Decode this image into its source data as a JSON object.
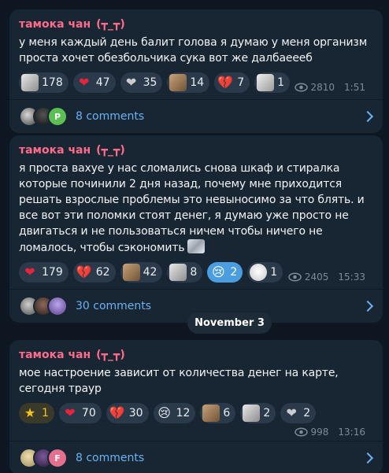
{
  "posts": [
    {
      "author": "тамока чан",
      "author_kaomoji": "(┳_┳)",
      "text": "у меня каждый день балит голова я думаю у меня организм проста хочет обезбольчика сука вот же далбаеееб",
      "reactions": [
        {
          "icon": "sticker-meme-face",
          "count": "178"
        },
        {
          "icon": "red-heart",
          "count": "47"
        },
        {
          "icon": "sticker-gray-heart",
          "count": "35"
        },
        {
          "icon": "sticker-cat-face",
          "count": "14"
        },
        {
          "icon": "broken-heart",
          "count": "7"
        },
        {
          "icon": "sticker-troll-face",
          "count": "1"
        }
      ],
      "views": "2810",
      "time": "1:51",
      "comments": "8 comments",
      "commenter_badge": "P"
    },
    {
      "author": "тамока чан",
      "author_kaomoji": "(┳_┳)",
      "text": "я проста вахуе у нас сломались снова шкаф и стиралка которые починили 2 дня назад, почему мне приходится решать взрослые проблемы это невыносимо за что блять. и все вот эти поломки стоят денег, я думаю уже просто не двигаться и не пользоваться ничем чтобы ничего не ломалось, чтобы сэкономить",
      "reactions": [
        {
          "icon": "red-heart",
          "count": "179"
        },
        {
          "icon": "broken-heart",
          "count": "62"
        },
        {
          "icon": "sticker-cat-face",
          "count": "42"
        },
        {
          "icon": "sticker-meme-face",
          "count": "8"
        },
        {
          "icon": "crying-face",
          "count": "2"
        },
        {
          "icon": "sticker-white-blob",
          "count": "1"
        }
      ],
      "views": "2405",
      "time": "15:33",
      "comments": "30 comments"
    },
    {
      "author": "тамока чан",
      "author_kaomoji": "(┳_┳)",
      "text": "мое настроение зависит от количества денег на карте, сегодня траур",
      "reactions": [
        {
          "icon": "star",
          "count": "1"
        },
        {
          "icon": "red-heart",
          "count": "70"
        },
        {
          "icon": "broken-heart",
          "count": "30"
        },
        {
          "icon": "crying-face",
          "count": "12"
        },
        {
          "icon": "sticker-cat-face",
          "count": "6"
        },
        {
          "icon": "sticker-meme-face",
          "count": "2"
        },
        {
          "icon": "sticker-gray-heart",
          "count": "2"
        }
      ],
      "views": "998",
      "time": "13:16",
      "comments": "8 comments",
      "commenter_badge": "F"
    }
  ],
  "date_separator": "November 3",
  "colors": {
    "background": "#0e1621",
    "bubble": "#182533",
    "author": "#ff6b8a",
    "link": "#6ab2f2",
    "meta": "#7d8b99",
    "active_reaction": "#4a9de0"
  }
}
